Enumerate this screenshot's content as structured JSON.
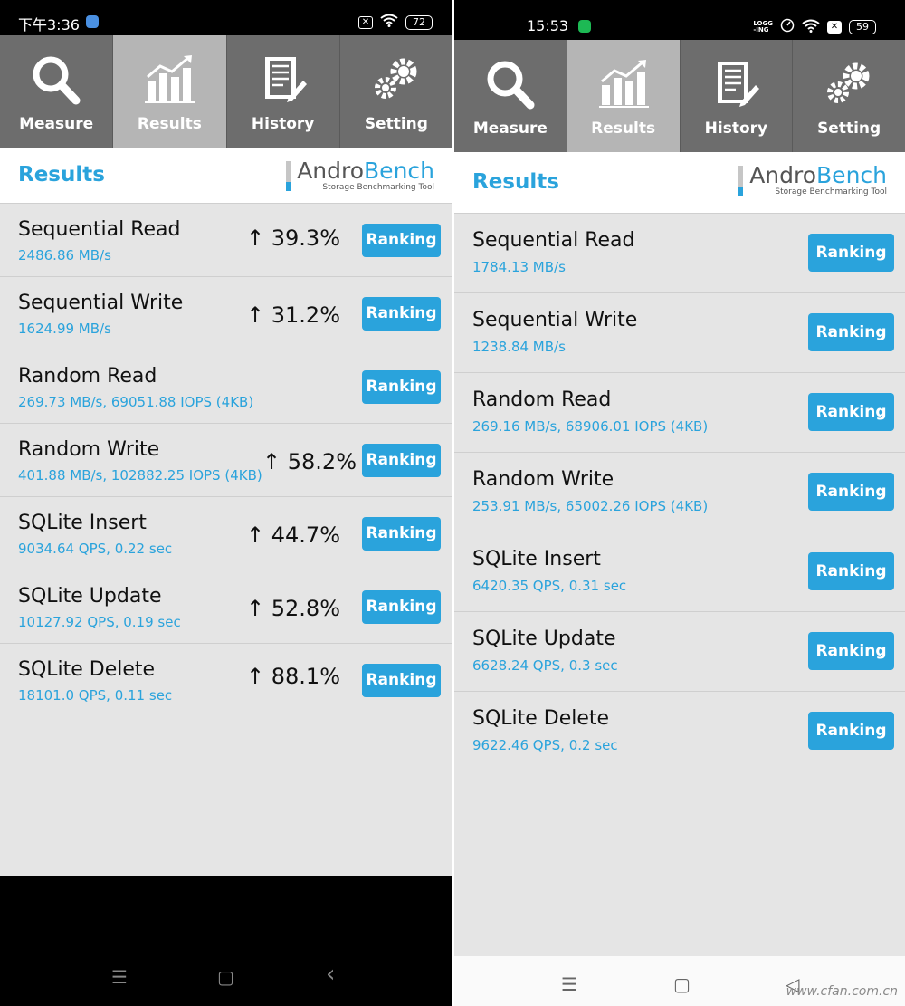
{
  "left": {
    "status": {
      "time": "下午3:36",
      "battery": "72"
    },
    "tabs": [
      {
        "label": "Measure",
        "icon": "search-icon"
      },
      {
        "label": "Results",
        "icon": "chart-icon"
      },
      {
        "label": "History",
        "icon": "document-icon"
      },
      {
        "label": "Setting",
        "icon": "gear-icon"
      }
    ],
    "header": {
      "title": "Results",
      "logo_a": "Andro",
      "logo_b": "Bench",
      "tagline": "Storage Benchmarking Tool"
    },
    "rows": [
      {
        "name": "Sequential Read",
        "value": "2486.86 MB/s",
        "delta": "39.3%",
        "button": "Ranking"
      },
      {
        "name": "Sequential Write",
        "value": "1624.99 MB/s",
        "delta": "31.2%",
        "button": "Ranking"
      },
      {
        "name": "Random Read",
        "value": "269.73 MB/s, 69051.88 IOPS (4KB)",
        "delta": "",
        "button": "Ranking"
      },
      {
        "name": "Random Write",
        "value": "401.88 MB/s, 102882.25 IOPS (4KB)",
        "delta": "58.2%",
        "button": "Ranking"
      },
      {
        "name": "SQLite Insert",
        "value": "9034.64 QPS, 0.22 sec",
        "delta": "44.7%",
        "button": "Ranking"
      },
      {
        "name": "SQLite Update",
        "value": "10127.92 QPS, 0.19 sec",
        "delta": "52.8%",
        "button": "Ranking"
      },
      {
        "name": "SQLite Delete",
        "value": "18101.0 QPS, 0.11 sec",
        "delta": "88.1%",
        "button": "Ranking"
      }
    ],
    "nav": {
      "menu": "☰",
      "home": "▢",
      "back": "‹"
    }
  },
  "right": {
    "status": {
      "time": "15:53",
      "battery": "59",
      "logging": "LOGG\n-ING"
    },
    "tabs": [
      {
        "label": "Measure",
        "icon": "search-icon"
      },
      {
        "label": "Results",
        "icon": "chart-icon"
      },
      {
        "label": "History",
        "icon": "document-icon"
      },
      {
        "label": "Setting",
        "icon": "gear-icon"
      }
    ],
    "header": {
      "title": "Results",
      "logo_a": "Andro",
      "logo_b": "Bench",
      "tagline": "Storage Benchmarking Tool"
    },
    "rows": [
      {
        "name": "Sequential Read",
        "value": "1784.13 MB/s",
        "button": "Ranking"
      },
      {
        "name": "Sequential Write",
        "value": "1238.84 MB/s",
        "button": "Ranking"
      },
      {
        "name": "Random Read",
        "value": "269.16 MB/s, 68906.01 IOPS (4KB)",
        "button": "Ranking"
      },
      {
        "name": "Random Write",
        "value": "253.91 MB/s, 65002.26 IOPS (4KB)",
        "button": "Ranking"
      },
      {
        "name": "SQLite Insert",
        "value": "6420.35 QPS, 0.31 sec",
        "button": "Ranking"
      },
      {
        "name": "SQLite Update",
        "value": "6628.24 QPS, 0.3 sec",
        "button": "Ranking"
      },
      {
        "name": "SQLite Delete",
        "value": "9622.46 QPS, 0.2 sec",
        "button": "Ranking"
      }
    ],
    "nav": {
      "menu": "☰",
      "home": "▢",
      "back": "◁"
    },
    "watermark": "www.cfan.com.cn"
  },
  "colors": {
    "accent": "#2aa3dc",
    "toolbar": "#6d6d6d",
    "toolbar_active": "#b5b5b5",
    "list_bg": "#e5e5e5"
  }
}
